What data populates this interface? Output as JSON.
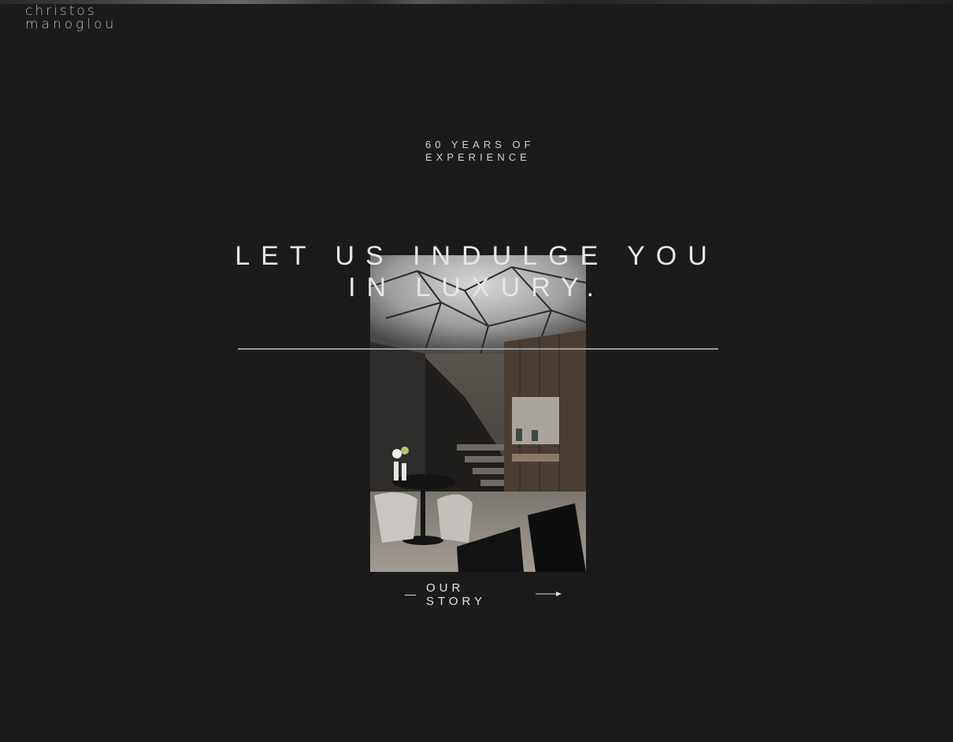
{
  "brand": {
    "line1": "christos",
    "line2": "manoglou"
  },
  "hero": {
    "eyebrow": "60 YEARS OF EXPERIENCE",
    "headline": "LET US INDULGE YOU IN LUXURY.",
    "cta_label": "OUR STORY"
  },
  "icons": {
    "cta_arrow": "right-arrow-icon",
    "cta_dash": "dash-icon"
  },
  "colors": {
    "background": "#1b1b1b",
    "text": "#e6e6e6",
    "rule": "#9a9a9a"
  }
}
